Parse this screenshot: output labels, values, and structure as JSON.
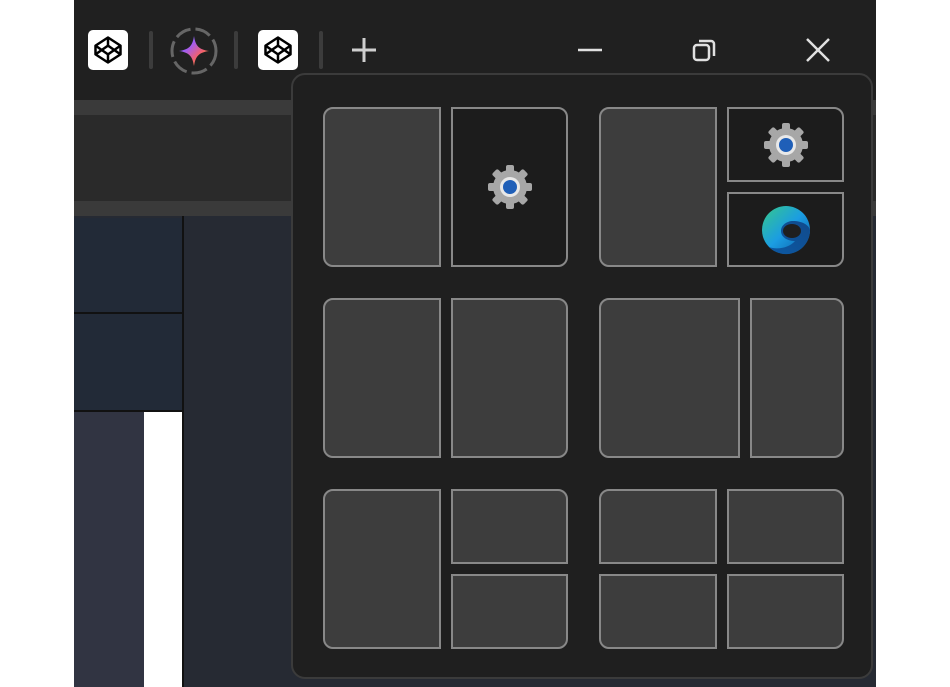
{
  "window": {
    "tabs": [
      {
        "icon": "codepen-icon",
        "kind": "codepen"
      },
      {
        "icon": "copilot-icon",
        "kind": "copilot"
      },
      {
        "icon": "codepen-icon",
        "kind": "codepen"
      }
    ],
    "new_tab_icon": "plus-icon",
    "controls": [
      "minimize-icon",
      "restore-icon",
      "close-icon"
    ]
  },
  "snap_layouts": {
    "layouts": [
      {
        "name": "half-half",
        "zones": [
          {
            "app": null
          },
          {
            "app": "settings"
          }
        ]
      },
      {
        "name": "half-two-stacked",
        "zones": [
          {
            "app": null
          },
          {
            "app": "settings"
          },
          {
            "app": "edge"
          }
        ]
      },
      {
        "name": "half-half-plain",
        "zones": [
          {
            "app": null
          },
          {
            "app": null
          }
        ]
      },
      {
        "name": "wide-narrow",
        "zones": [
          {
            "app": null
          },
          {
            "app": null
          }
        ]
      },
      {
        "name": "half-two-stacked-plain",
        "zones": [
          {
            "app": null
          },
          {
            "app": null
          },
          {
            "app": null
          }
        ]
      },
      {
        "name": "quadrants",
        "zones": [
          {
            "app": null
          },
          {
            "app": null
          },
          {
            "app": null
          },
          {
            "app": null
          }
        ]
      }
    ]
  },
  "colors": {
    "window_bg": "#202020",
    "zone_fill": "#3d3d3d",
    "zone_border": "#888888",
    "flyout_bg": "#1f1f1f"
  }
}
